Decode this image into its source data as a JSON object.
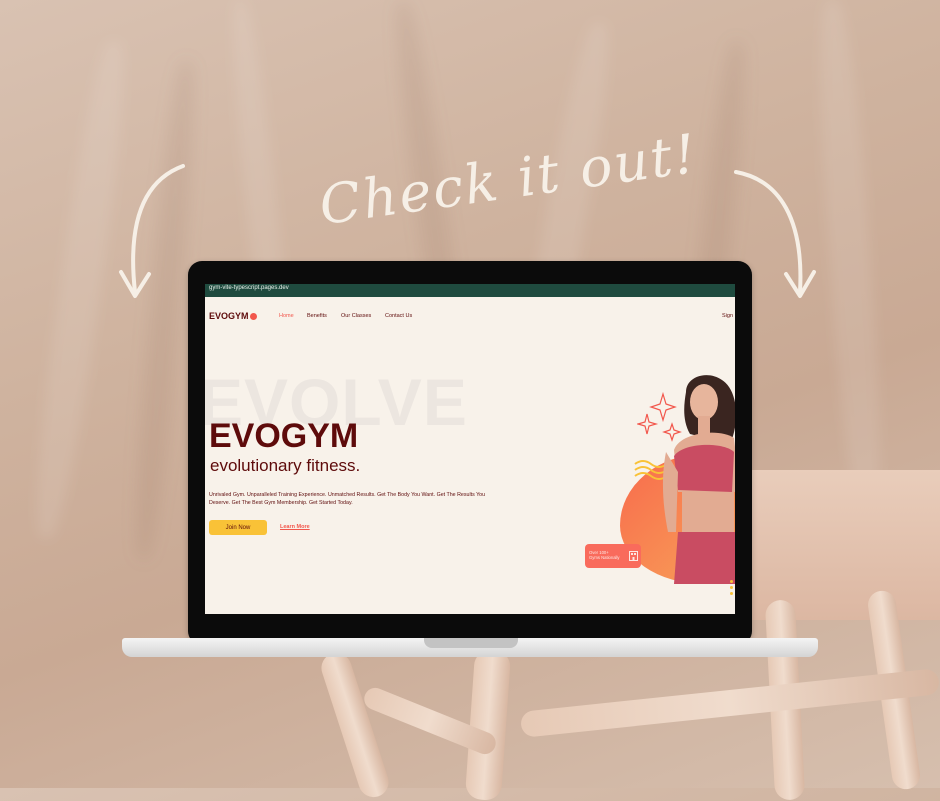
{
  "headline": "Check it out!",
  "site": {
    "url": "gym-vite-typescript.pages.dev",
    "logo": "EVOGYM",
    "nav": [
      "Home",
      "Benefits",
      "Our Classes",
      "Contact Us"
    ],
    "sign_in": "Sign",
    "bg_word": "EVOLVE",
    "title": "EVOGYM",
    "subtitle": "evolutionary fitness.",
    "description": "Unrivaled Gym. Unparalleled Training Experience. Unmatched Results. Get The Body You Want. Get The Results You Deserve. Get The Best Gym Membership. Get Started Today.",
    "join_label": "Join Now",
    "learn_label": "Learn More",
    "badge_line1": "Over 100+",
    "badge_line2": "Gyms Nationally"
  },
  "colors": {
    "brand": "#5e0b0b",
    "accent": "#f2574c",
    "button": "#f9c237",
    "urlbar": "#1f4b3f"
  },
  "icons": [
    "arrow-left-icon",
    "arrow-right-icon",
    "logo-dot-icon",
    "sparkle-icon",
    "building-icon"
  ]
}
